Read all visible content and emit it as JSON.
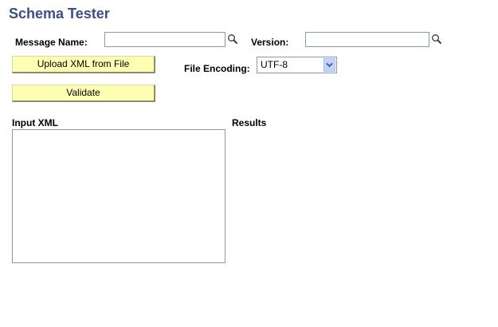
{
  "page": {
    "title": "Schema Tester"
  },
  "form": {
    "message_name_label": "Message Name:",
    "message_name_value": "",
    "version_label": "Version:",
    "version_value": "",
    "upload_button_label": "Upload XML from File",
    "file_encoding_label": "File Encoding:",
    "file_encoding_value": "UTF-8",
    "validate_button_label": "Validate"
  },
  "panels": {
    "input_xml_label": "Input XML",
    "input_xml_value": "",
    "results_label": "Results"
  },
  "icons": {
    "lookup": "magnifier-lookup-icon",
    "dropdown": "chevron-down-icon"
  },
  "colors": {
    "title": "#3b4f8a",
    "button_bg": "#ffffb3",
    "field_border": "#7f9db9"
  }
}
